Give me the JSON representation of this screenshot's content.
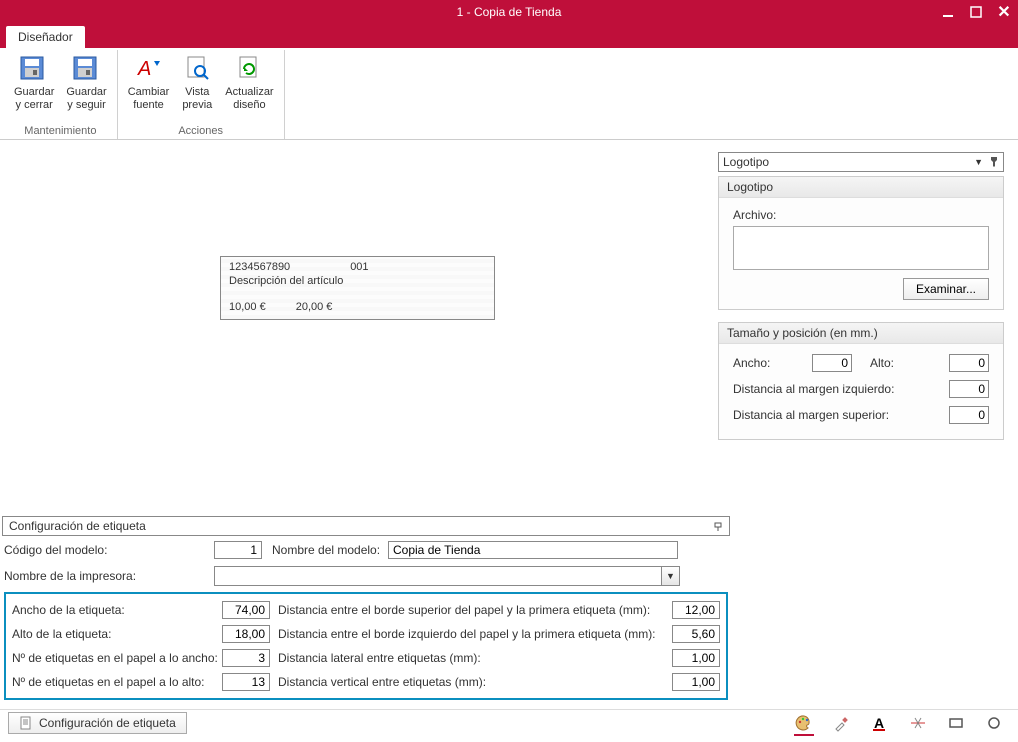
{
  "window": {
    "title": "1 - Copia de Tienda"
  },
  "tabs": {
    "designer": "Diseñador"
  },
  "ribbon": {
    "group_maintenance": "Mantenimiento",
    "group_actions": "Acciones",
    "save_close_l1": "Guardar",
    "save_close_l2": "y cerrar",
    "save_cont_l1": "Guardar",
    "save_cont_l2": "y seguir",
    "change_font_l1": "Cambiar",
    "change_font_l2": "fuente",
    "preview_l1": "Vista",
    "preview_l2": "previa",
    "update_l1": "Actualizar",
    "update_l2": "diseño"
  },
  "preview": {
    "code": "1234567890",
    "seq": "001",
    "desc": "Descripción del artículo",
    "price1": "10,00  €",
    "price2": "20,00  €"
  },
  "right": {
    "combo": "Logotipo",
    "logo_header": "Logotipo",
    "file_label": "Archivo:",
    "examine": "Examinar...",
    "size_header": "Tamaño y posición (en mm.)",
    "width_label": "Ancho:",
    "width_val": "0",
    "height_label": "Alto:",
    "height_val": "0",
    "dist_left_label": "Distancia al margen izquierdo:",
    "dist_left_val": "0",
    "dist_top_label": "Distancia al margen superior:",
    "dist_top_val": "0"
  },
  "config": {
    "header": "Configuración de etiqueta",
    "model_code_label": "Código del modelo:",
    "model_code": "1",
    "model_name_label": "Nombre del modelo:",
    "model_name": "Copia de Tienda",
    "printer_label": "Nombre de la impresora:",
    "width_label": "Ancho de la etiqueta:",
    "width": "74,00",
    "height_label": "Alto de la etiqueta:",
    "height": "18,00",
    "nx_label": "Nº de  etiquetas en el papel a lo ancho:",
    "nx": "3",
    "ny_label": "Nº de  etiquetas en el papel a lo alto:",
    "ny": "13",
    "dtop_label": "Distancia entre el borde superior del papel y la primera etiqueta (mm):",
    "dtop": "12,00",
    "dleft_label": "Distancia entre el borde izquierdo del papel y la primera etiqueta (mm):",
    "dleft": "5,60",
    "dlat_label": "Distancia lateral entre etiquetas (mm):",
    "dlat": "1,00",
    "dvert_label": "Distancia vertical  entre etiquetas (mm):",
    "dvert": "1,00",
    "bottom_tab": "Configuración de etiqueta"
  }
}
